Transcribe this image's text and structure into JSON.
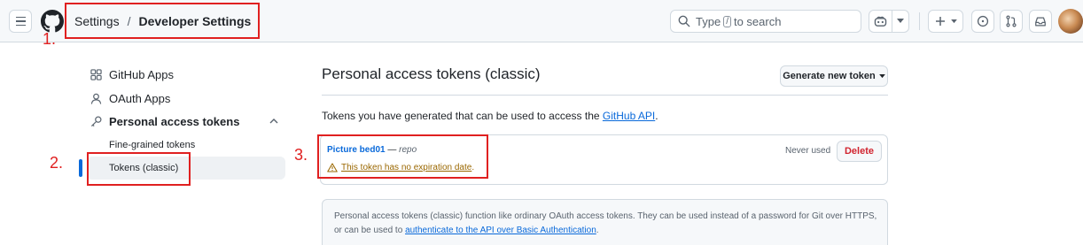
{
  "header": {
    "breadcrumb": [
      "Settings",
      "Developer Settings"
    ],
    "separator": "/",
    "search_prefix": "Type",
    "search_kbd": "/",
    "search_suffix": "to search"
  },
  "sidebar": {
    "items": [
      {
        "label": "GitHub Apps",
        "icon": "apps-icon"
      },
      {
        "label": "OAuth Apps",
        "icon": "person-icon"
      },
      {
        "label": "Personal access tokens",
        "icon": "key-icon"
      }
    ],
    "subitems": [
      "Fine-grained tokens",
      "Tokens (classic)"
    ],
    "selected": "Tokens (classic)"
  },
  "main": {
    "title": "Personal access tokens (classic)",
    "generate_button": "Generate new token",
    "description_text": "Tokens you have generated that can be used to access the ",
    "description_link": "GitHub API",
    "description_end": ".",
    "token": {
      "name": "Picture bed01",
      "dash": " — ",
      "scope": "repo",
      "warning": "This token has no expiration date",
      "warning_end": ".",
      "last_used": "Never used",
      "delete_label": "Delete"
    },
    "info": {
      "text": "Personal access tokens (classic) function like ordinary OAuth access tokens. They can be used instead of a password for Git over HTTPS, or can be used to ",
      "link": "authenticate to the API over Basic Authentication",
      "end": "."
    }
  },
  "annotations": [
    "1.",
    "2.",
    "3."
  ],
  "colors": {
    "accent": "#0969da",
    "danger": "#d1242f",
    "warning": "#9a6700",
    "annotation": "#e02020"
  }
}
